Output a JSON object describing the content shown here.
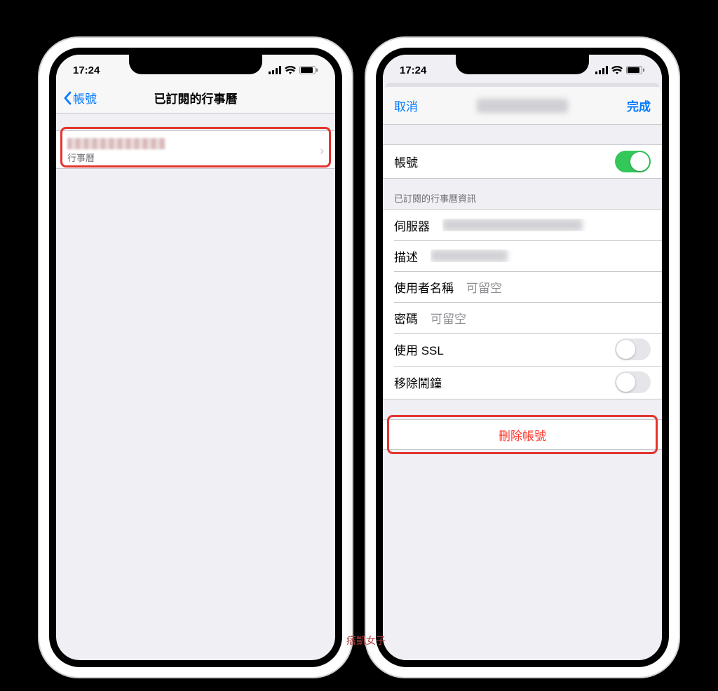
{
  "status": {
    "time": "17:24"
  },
  "phone1": {
    "back": "帳號",
    "title": "已訂閱的行事曆",
    "row_sub": "行事曆"
  },
  "phone2": {
    "cancel": "取消",
    "done": "完成",
    "account_label": "帳號",
    "section_header": "已訂閱的行事曆資訊",
    "server_label": "伺服器",
    "desc_label": "描述",
    "username_label": "使用者名稱",
    "username_placeholder": "可留空",
    "password_label": "密碼",
    "password_placeholder": "可留空",
    "ssl_label": "使用 SSL",
    "alarm_label": "移除鬧鐘",
    "delete": "刪除帳號"
  },
  "watermark": "痞凱女子"
}
